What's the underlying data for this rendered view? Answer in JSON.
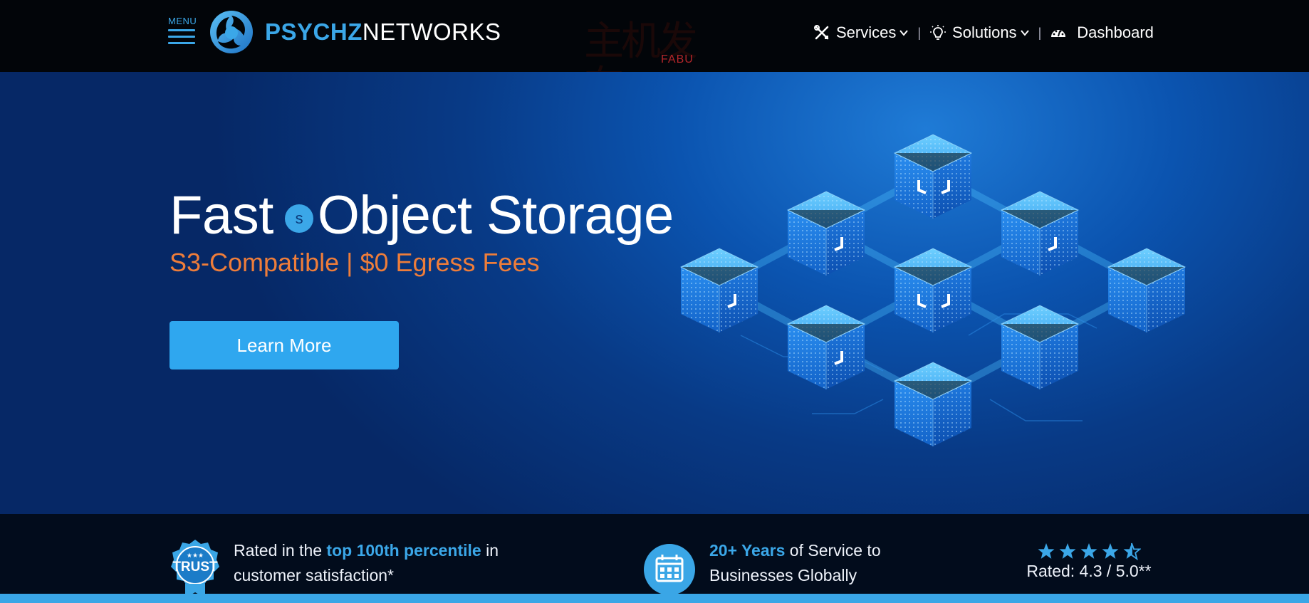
{
  "header": {
    "menu_label": "MENU",
    "logo_bold": "PSYCHZ",
    "logo_rest": "NETWORKS",
    "watermark": "主机发布",
    "watermark_sub": "FABU",
    "nav": [
      {
        "label": "Services",
        "icon": "tools-icon",
        "has_dropdown": true
      },
      {
        "label": "Solutions",
        "icon": "lightbulb-icon",
        "has_dropdown": true
      },
      {
        "label": "Dashboard",
        "icon": "gauge-icon",
        "has_dropdown": false
      }
    ],
    "separator": "|"
  },
  "hero": {
    "title_before": "Fast",
    "badge": "s",
    "title_after": "Object Storage",
    "subtitle": "S3-Compatible | $0 Egress Fees",
    "cta_label": "Learn More",
    "illustration": "storage-cubes-network-illustration"
  },
  "trust": {
    "item1": {
      "icon": "trust-badge-icon",
      "badge_text": "TRUST",
      "text_before": "Rated in the ",
      "highlight": "top 100th percentile",
      "text_after": " in customer satisfaction*"
    },
    "item2": {
      "icon": "calendar-icon",
      "highlight": "20+ Years",
      "text_after": " of Service to Businesses Globally"
    },
    "rating": {
      "stars": 4.5,
      "text": "Rated: 4.3 / 5.0**"
    }
  },
  "colors": {
    "accent": "#3ba7e8",
    "orange": "#ee7d3a",
    "header_bg": "#020509",
    "hero_bg": "#0b54b0",
    "trust_bg": "#020c1c"
  }
}
